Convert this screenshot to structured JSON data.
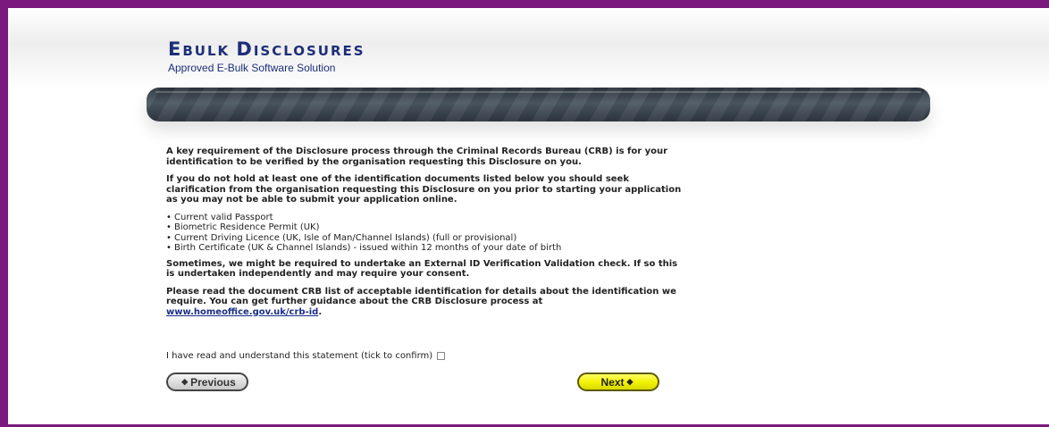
{
  "brand": {
    "title_first": "E",
    "title_rest_1": "BULK ",
    "title_big_2": "D",
    "title_rest_2": "ISCLOSURES",
    "subtitle": "Approved E-Bulk Software Solution",
    "frame_color": "#7b1a7e",
    "title_color": "#1d2e79"
  },
  "content": {
    "para1": "A key requirement of the Disclosure process through the Criminal Records Bureau (CRB) is for your identification to be verified by the organisation requesting this Disclosure on you.",
    "para2": "If you do not hold at least one of the identification documents listed below you should seek clarification from the organisation requesting this Disclosure on you prior to starting your application as you may not be able to submit your application online.",
    "list": [
      "Current valid Passport",
      "Biometric Residence Permit (UK)",
      "Current Driving Licence (UK, Isle of Man/Channel Islands) (full or provisional)",
      "Birth Certificate (UK & Channel Islands) - issued within 12 months of your date of birth"
    ],
    "para3": "Sometimes, we might be required to undertake an External ID Verification Validation check. If so this is undertaken independently and may require your consent.",
    "para4_text": "Please read the document CRB list of acceptable identification for details about the identification we require. You can get further guidance about the CRB Disclosure process at",
    "para4_link": "www.homeoffice.gov.uk/crb-id",
    "para4_end": "."
  },
  "confirm": {
    "label": "I have read and understand this statement (tick to confirm)",
    "checked": false
  },
  "buttons": {
    "previous_label": "Previous",
    "next_label": "Next",
    "previous_icon": "arrow-left-icon",
    "next_icon": "arrow-right-icon"
  }
}
